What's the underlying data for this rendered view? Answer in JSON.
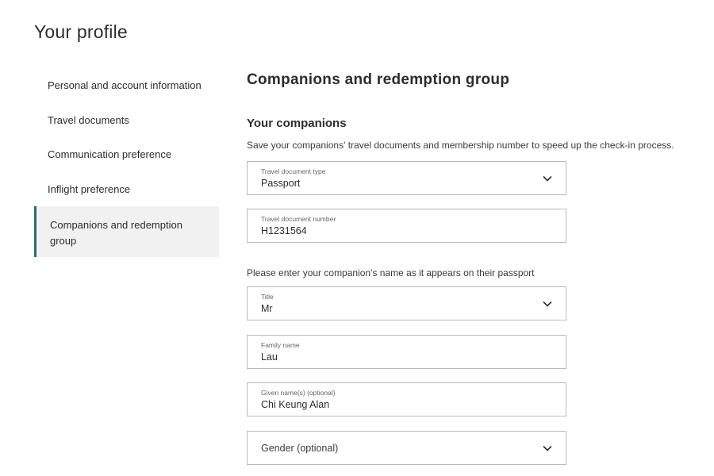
{
  "page_title": "Your profile",
  "sidebar": {
    "items": [
      {
        "label": "Personal and account information"
      },
      {
        "label": "Travel documents"
      },
      {
        "label": "Communication preference"
      },
      {
        "label": "Inflight preference"
      },
      {
        "label": "Companions and redemption group",
        "active": true
      }
    ]
  },
  "main": {
    "section_title": "Companions and redemption group",
    "sub_title": "Your companions",
    "description": "Save your companions' travel documents and membership number to speed up the check-in process.",
    "name_note": "Please enter your companion's name as it appears on their passport",
    "fields": {
      "doc_type": {
        "label": "Travel document type",
        "value": "Passport",
        "icon": "chevron-down-icon"
      },
      "doc_number": {
        "label": "Travel document number",
        "value": "H1231564"
      },
      "title": {
        "label": "Title",
        "value": "Mr",
        "icon": "chevron-down-icon"
      },
      "family_name": {
        "label": "Family name",
        "value": "Lau"
      },
      "given_names": {
        "label": "Given name(s) (optional)",
        "value": "Chi Keung Alan"
      },
      "gender": {
        "placeholder": "Gender (optional)",
        "icon": "chevron-down-icon"
      }
    }
  },
  "colors": {
    "accent": "#2e6b6c",
    "active_bg": "#f1f1f1",
    "border": "#b9b9b9",
    "text": "#2d2d2d"
  }
}
